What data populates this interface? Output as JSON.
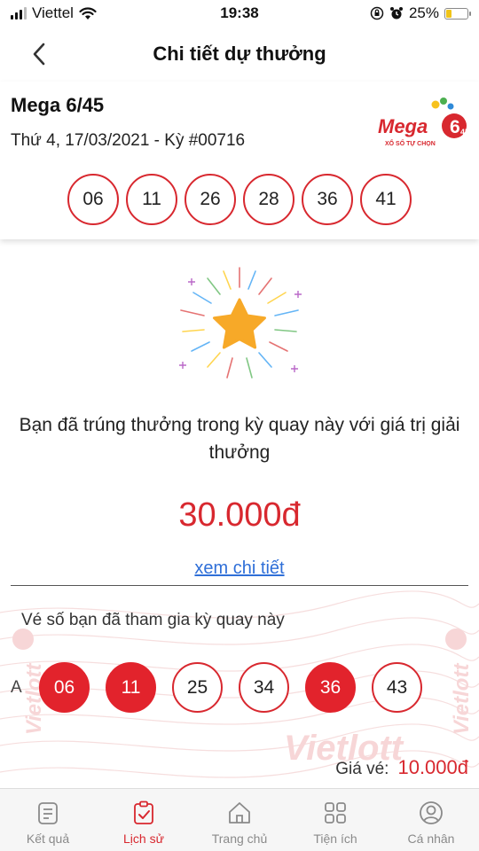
{
  "status": {
    "carrier": "Viettel",
    "time": "19:38",
    "battery": "25%",
    "battery_level": 0.25
  },
  "header": {
    "title": "Chi tiết dự thưởng"
  },
  "draw": {
    "game": "Mega 6/45",
    "info": "Thứ 4, 17/03/2021 - Kỳ #00716",
    "numbers": [
      "06",
      "11",
      "26",
      "28",
      "36",
      "41"
    ],
    "logo": {
      "word": "Mega",
      "badge_main": "6",
      "badge_sub": "45",
      "tagline": "XỔ SỐ TỰ CHỌN"
    }
  },
  "result": {
    "message": "Bạn đã trúng thưởng trong kỳ quay này với giá trị giải thưởng",
    "amount": "30.000đ",
    "detail_link": "xem chi tiết"
  },
  "ticket": {
    "heading": "Vé số bạn đã tham gia kỳ quay này",
    "row_label": "A",
    "numbers": [
      {
        "value": "06",
        "matched": true
      },
      {
        "value": "11",
        "matched": true
      },
      {
        "value": "25",
        "matched": false
      },
      {
        "value": "34",
        "matched": false
      },
      {
        "value": "36",
        "matched": true
      },
      {
        "value": "43",
        "matched": false
      }
    ],
    "price_label": "Giá vé:",
    "price": "10.000đ",
    "watermark": "Vietlott"
  },
  "tabs": [
    {
      "label": "Kết quả",
      "icon": "results-icon",
      "active": false
    },
    {
      "label": "Lịch sử",
      "icon": "history-icon",
      "active": true
    },
    {
      "label": "Trang chủ",
      "icon": "home-icon",
      "active": false
    },
    {
      "label": "Tiện ích",
      "icon": "utilities-icon",
      "active": false
    },
    {
      "label": "Cá nhân",
      "icon": "profile-icon",
      "active": false
    }
  ],
  "colors": {
    "accent": "#d8282f",
    "link": "#2f6fd8",
    "star": "#f7a928"
  }
}
